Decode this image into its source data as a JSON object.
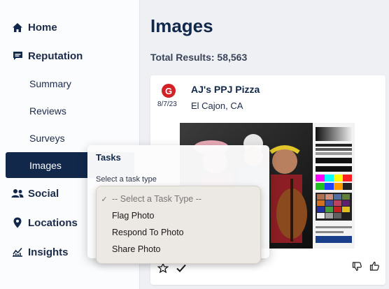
{
  "sidebar": {
    "home": "Home",
    "reputation": "Reputation",
    "sub_items": [
      "Summary",
      "Reviews",
      "Surveys",
      "Images"
    ],
    "social": "Social",
    "locations": "Locations",
    "insights": "Insights"
  },
  "main": {
    "title": "Images",
    "total": "Total Results: 58,563"
  },
  "card": {
    "source_logo": "G",
    "date": "8/7/23",
    "name": "AJ's PPJ Pizza",
    "location": "El Cajon, CA"
  },
  "tasks": {
    "title": "Tasks",
    "label": "Select a task type",
    "options": [
      "-- Select a Task Type --",
      "Flag Photo",
      "Respond To Photo",
      "Share Photo"
    ],
    "selected": "-- Select a Task Type --",
    "checkmark": "✓"
  },
  "colors": {
    "navy": "#12284b",
    "google_red": "#d32128"
  },
  "icons": {
    "home": "home-icon",
    "reputation": "chat-icon",
    "social": "users-icon",
    "locations": "map-pin-icon",
    "insights": "chart-icon",
    "star": "star-icon",
    "check": "check-icon",
    "thumbs_down": "thumbs-down-icon",
    "thumbs_up": "thumbs-up-icon"
  }
}
